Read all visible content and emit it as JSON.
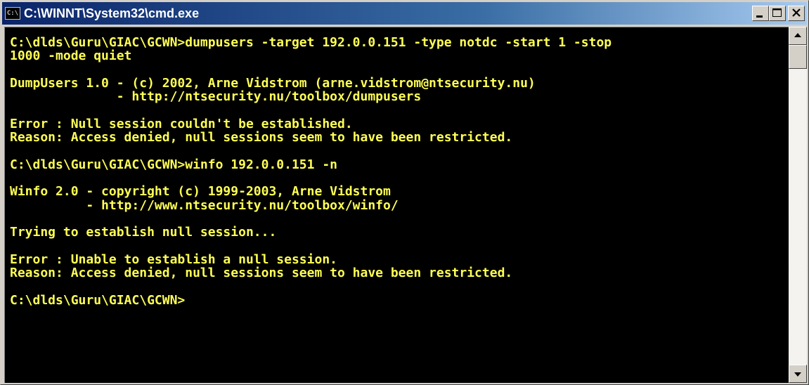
{
  "window": {
    "title": "C:\\WINNT\\System32\\cmd.exe",
    "icon": "cmd-window-icon",
    "icon_glyph": "C:\\",
    "buttons": {
      "minimize_icon": "minimize-icon",
      "maximize_icon": "maximize-icon",
      "close_icon": "close-icon"
    }
  },
  "console": {
    "text_color": "#ffff55",
    "background_color": "#000000",
    "lines": [
      "C:\\dlds\\Guru\\GIAC\\GCWN>dumpusers -target 192.0.0.151 -type notdc -start 1 -stop",
      "1000 -mode quiet",
      "",
      "DumpUsers 1.0 - (c) 2002, Arne Vidstrom (arne.vidstrom@ntsecurity.nu)",
      "              - http://ntsecurity.nu/toolbox/dumpusers",
      "",
      "Error : Null session couldn't be established.",
      "Reason: Access denied, null sessions seem to have been restricted.",
      "",
      "C:\\dlds\\Guru\\GIAC\\GCWN>winfo 192.0.0.151 -n",
      "",
      "Winfo 2.0 - copyright (c) 1999-2003, Arne Vidstrom",
      "          - http://www.ntsecurity.nu/toolbox/winfo/",
      "",
      "Trying to establish null session...",
      "",
      "Error : Unable to establish a null session.",
      "Reason: Access denied, null sessions seem to have been restricted.",
      "",
      "C:\\dlds\\Guru\\GIAC\\GCWN>"
    ]
  },
  "scrollbar": {
    "up_icon": "scroll-up-arrow-icon",
    "down_icon": "scroll-down-arrow-icon"
  }
}
